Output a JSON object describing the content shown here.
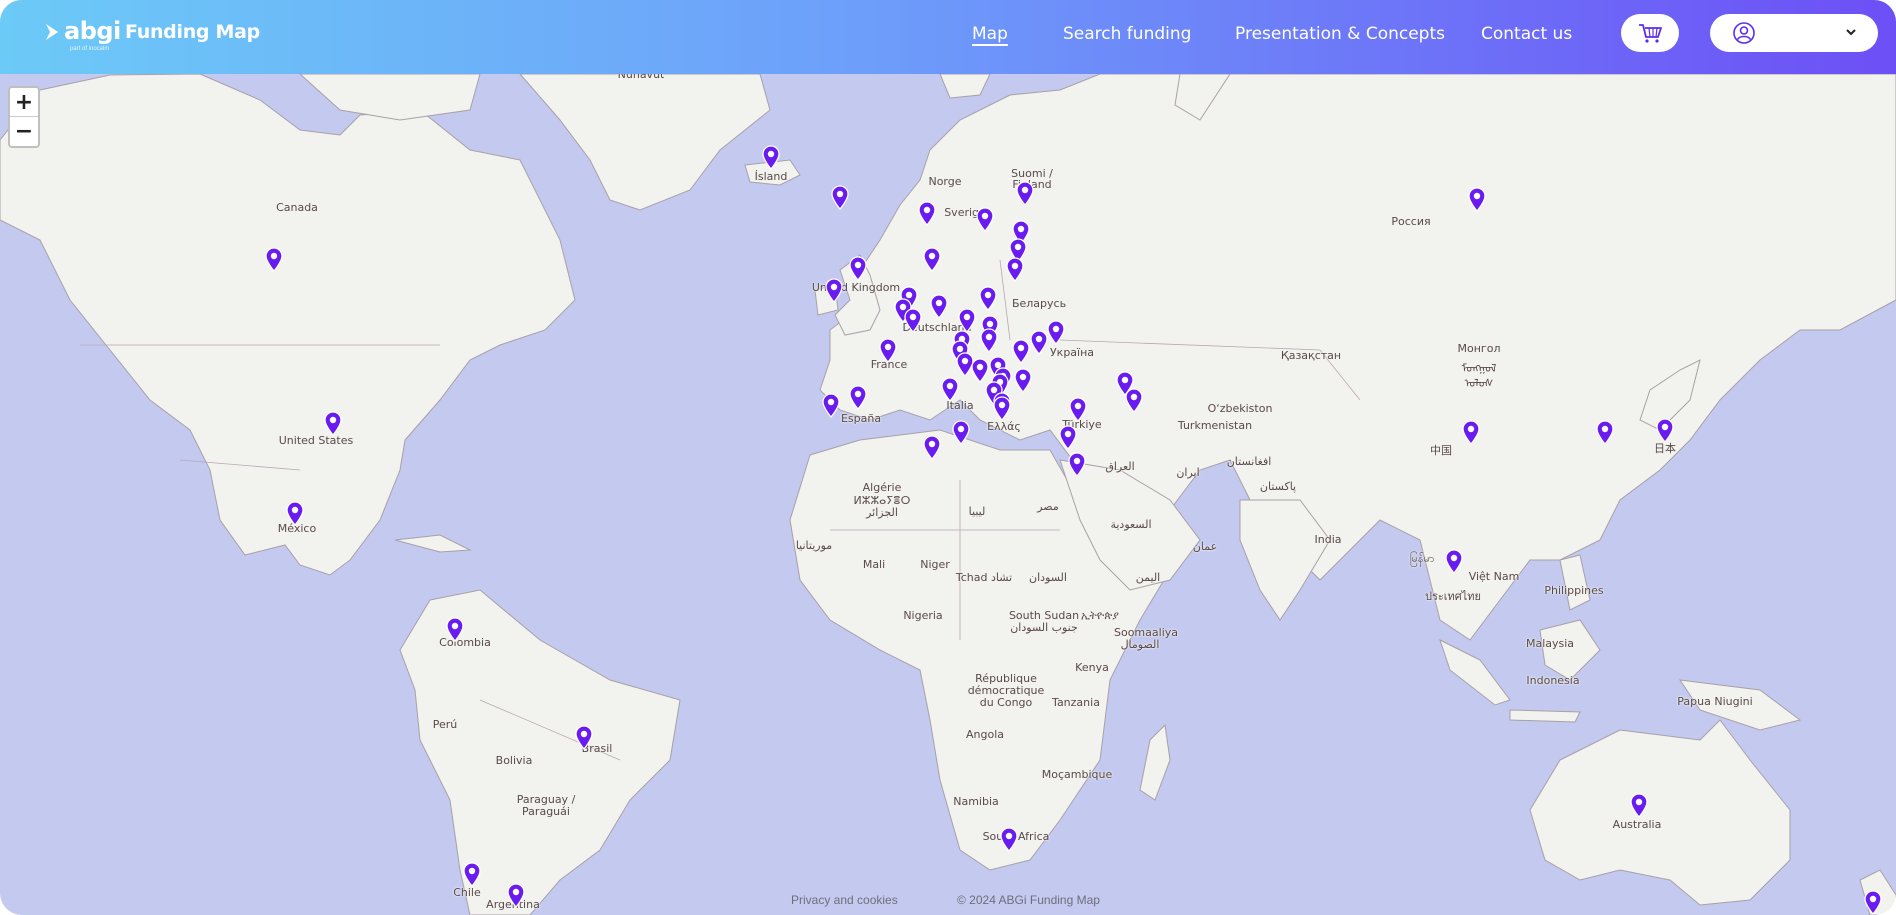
{
  "brand": {
    "logo_text": "abgi",
    "logo_subtext": "part of inocalm",
    "app_title": "Funding Map"
  },
  "nav": {
    "map": "Map",
    "search": "Search funding",
    "presentation": "Presentation & Concepts",
    "contact": "Contact us"
  },
  "header_icons": {
    "cart": "cart-icon",
    "user": "user-icon",
    "dropdown": "chevron-down-icon"
  },
  "zoom": {
    "in": "+",
    "out": "−"
  },
  "places": [
    {
      "id": "nunavut",
      "text": "Nunavut"
    },
    {
      "id": "island",
      "text": "Ísland"
    },
    {
      "id": "canada",
      "text": "Canada"
    },
    {
      "id": "norge",
      "text": "Norge"
    },
    {
      "id": "sverige",
      "text": "Sverige"
    },
    {
      "id": "suomi1",
      "text": "Suomi /"
    },
    {
      "id": "suomi2",
      "text": "Finland"
    },
    {
      "id": "russia",
      "text": "Россия"
    },
    {
      "id": "uk",
      "text": "United Kingdom"
    },
    {
      "id": "belarus",
      "text": "Беларусь"
    },
    {
      "id": "deutschland",
      "text": "Deutschland"
    },
    {
      "id": "ukraina",
      "text": "Україна"
    },
    {
      "id": "france",
      "text": "France"
    },
    {
      "id": "kazakhstan",
      "text": "Қазақстан"
    },
    {
      "id": "mongol1",
      "text": "Монгол"
    },
    {
      "id": "mongol2",
      "text": "ᠮᠣᠩᠭᠣᠯ"
    },
    {
      "id": "mongol3",
      "text": "ᠤᠯᠤᠰ"
    },
    {
      "id": "italia",
      "text": "Italia"
    },
    {
      "id": "espana",
      "text": "España"
    },
    {
      "id": "turkiye",
      "text": "Türkiye"
    },
    {
      "id": "uzbekistan",
      "text": "O‘zbekiston"
    },
    {
      "id": "turkmenistan",
      "text": "Turkmenistan"
    },
    {
      "id": "ellada",
      "text": "Ελλάς"
    },
    {
      "id": "usa",
      "text": "United States"
    },
    {
      "id": "china",
      "text": "中国"
    },
    {
      "id": "japan",
      "text": "日本"
    },
    {
      "id": "iraq",
      "text": "العراق"
    },
    {
      "id": "afghanistan",
      "text": "افغانستان"
    },
    {
      "id": "iran",
      "text": "ایران"
    },
    {
      "id": "pakistan",
      "text": "پاکستان"
    },
    {
      "id": "algerie1",
      "text": "Algérie"
    },
    {
      "id": "algerie2",
      "text": "ⵍⵣⵣⴰⵢⴻⵔ"
    },
    {
      "id": "algerie3",
      "text": "الجزائر"
    },
    {
      "id": "libya",
      "text": "ليبيا"
    },
    {
      "id": "misr",
      "text": "مصر"
    },
    {
      "id": "saudi",
      "text": "السعودية"
    },
    {
      "id": "mexico",
      "text": "México"
    },
    {
      "id": "india",
      "text": "India"
    },
    {
      "id": "mauritania",
      "text": "موريتانيا"
    },
    {
      "id": "mali",
      "text": "Mali"
    },
    {
      "id": "niger",
      "text": "Niger"
    },
    {
      "id": "tchad",
      "text": "Tchad تشاد"
    },
    {
      "id": "sudan",
      "text": "السودان"
    },
    {
      "id": "oman",
      "text": "عمان"
    },
    {
      "id": "myanmar",
      "text": "မြန်မာ"
    },
    {
      "id": "vietnam",
      "text": "Việt Nam"
    },
    {
      "id": "thailand",
      "text": "ประเทศไทย"
    },
    {
      "id": "yemen",
      "text": "اليمن"
    },
    {
      "id": "philippines",
      "text": "Philippines"
    },
    {
      "id": "nigeria",
      "text": "Nigeria"
    },
    {
      "id": "ssudan1",
      "text": "South Sudan"
    },
    {
      "id": "ssudan2",
      "text": "جنوب السودان"
    },
    {
      "id": "ethiopia",
      "text": "ኢትዮጵያ"
    },
    {
      "id": "somalia1",
      "text": "Soomaaliya"
    },
    {
      "id": "somalia2",
      "text": "الصومال"
    },
    {
      "id": "colombia",
      "text": "Colombia"
    },
    {
      "id": "malaysia",
      "text": "Malaysia"
    },
    {
      "id": "rdc1",
      "text": "République"
    },
    {
      "id": "rdc2",
      "text": "démocratique"
    },
    {
      "id": "rdc3",
      "text": "du Congo"
    },
    {
      "id": "kenya",
      "text": "Kenya"
    },
    {
      "id": "indonesia",
      "text": "Indonesia"
    },
    {
      "id": "tanzania",
      "text": "Tanzania"
    },
    {
      "id": "png",
      "text": "Papua Niugini"
    },
    {
      "id": "brasil",
      "text": "Brasil"
    },
    {
      "id": "peru",
      "text": "Perú"
    },
    {
      "id": "angola",
      "text": "Angola"
    },
    {
      "id": "bolivia",
      "text": "Bolivia"
    },
    {
      "id": "mocambique",
      "text": "Moçambique"
    },
    {
      "id": "paraguay1",
      "text": "Paraguay /"
    },
    {
      "id": "paraguay2",
      "text": "Paraguái"
    },
    {
      "id": "namibia",
      "text": "Namibia"
    },
    {
      "id": "australia",
      "text": "Australia"
    },
    {
      "id": "southafrica",
      "text": "South Africa"
    },
    {
      "id": "chile",
      "text": "Chile"
    },
    {
      "id": "argentina",
      "text": "Argentina"
    }
  ],
  "markers": [
    {
      "id": "iceland"
    },
    {
      "id": "faroe"
    },
    {
      "id": "canada"
    },
    {
      "id": "norway"
    },
    {
      "id": "sweden-n"
    },
    {
      "id": "finland"
    },
    {
      "id": "russia"
    },
    {
      "id": "sweden-s"
    },
    {
      "id": "estonia"
    },
    {
      "id": "latvia"
    },
    {
      "id": "lithuania"
    },
    {
      "id": "scotland"
    },
    {
      "id": "ireland"
    },
    {
      "id": "netherlands"
    },
    {
      "id": "belgium"
    },
    {
      "id": "luxembourg"
    },
    {
      "id": "germany-n"
    },
    {
      "id": "poland-n"
    },
    {
      "id": "germany-e"
    },
    {
      "id": "poland-s"
    },
    {
      "id": "ukraine"
    },
    {
      "id": "moldova"
    },
    {
      "id": "czechia"
    },
    {
      "id": "slovakia"
    },
    {
      "id": "austria"
    },
    {
      "id": "france"
    },
    {
      "id": "switzerland"
    },
    {
      "id": "hungary"
    },
    {
      "id": "slovenia"
    },
    {
      "id": "croatia"
    },
    {
      "id": "serbia"
    },
    {
      "id": "bosnia"
    },
    {
      "id": "romania"
    },
    {
      "id": "bulgaria"
    },
    {
      "id": "montenegro"
    },
    {
      "id": "georgia"
    },
    {
      "id": "armenia"
    },
    {
      "id": "usa"
    },
    {
      "id": "italy"
    },
    {
      "id": "portugal"
    },
    {
      "id": "spain"
    },
    {
      "id": "greece"
    },
    {
      "id": "turkey"
    },
    {
      "id": "malta"
    },
    {
      "id": "tunisia"
    },
    {
      "id": "cyprus"
    },
    {
      "id": "israel"
    },
    {
      "id": "mexico"
    },
    {
      "id": "china"
    },
    {
      "id": "korea"
    },
    {
      "id": "japan"
    },
    {
      "id": "thailand"
    },
    {
      "id": "colombia"
    },
    {
      "id": "brazil"
    },
    {
      "id": "australia"
    },
    {
      "id": "south-africa"
    },
    {
      "id": "chile"
    },
    {
      "id": "argentina"
    },
    {
      "id": "new-zealand"
    }
  ],
  "footer": {
    "privacy": "Privacy and cookies",
    "copyright": "© 2024 ABGi Funding Map"
  },
  "colors": {
    "accent": "#6a1bf0",
    "ocean": "#c3c9ef",
    "land": "#f2f2ee",
    "header_start": "#6ccaf7",
    "header_end": "#6d4ff6"
  }
}
